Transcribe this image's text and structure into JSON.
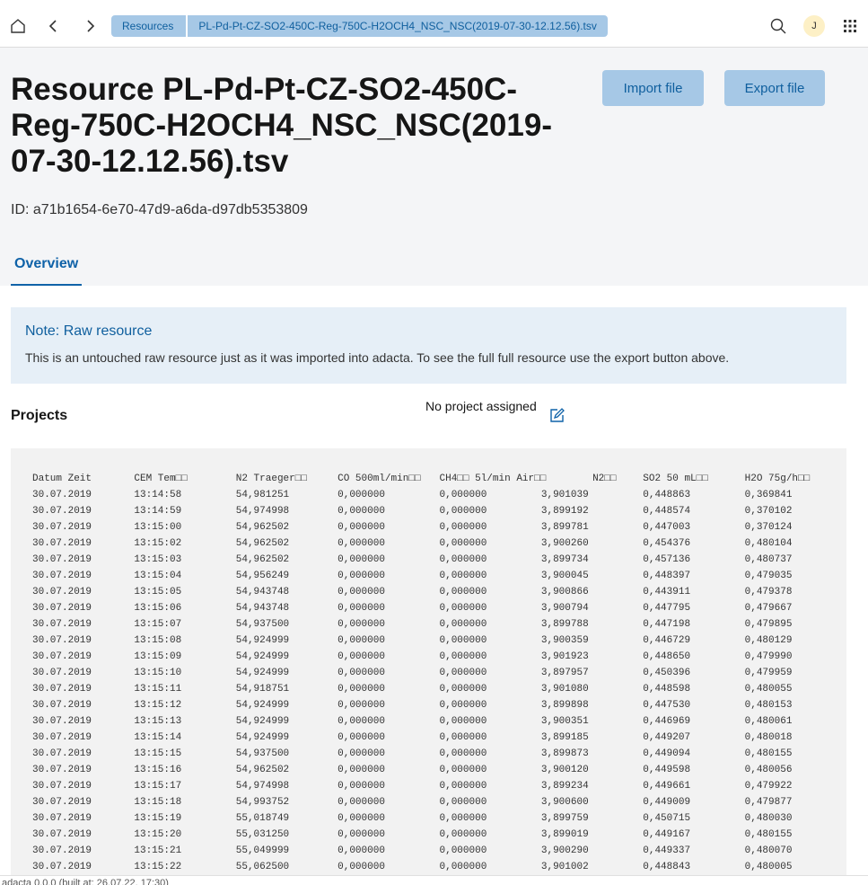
{
  "breadcrumb": {
    "first": "Resources",
    "second": "PL-Pd-Pt-CZ-SO2-450C-Reg-750C-H2OCH4_NSC_NSC(2019-07-30-12.12.56).tsv"
  },
  "header": {
    "avatar_initial": "J"
  },
  "page": {
    "title": "Resource PL-Pd-Pt-CZ-SO2-450C-Reg-750C-H2OCH4_NSC_NSC(2019-07-30-12.12.56).tsv",
    "id_text": "ID: a71b1654-6e70-47d9-a6da-d97db5353809",
    "import_label": "Import file",
    "export_label": "Export file",
    "tab_overview": "Overview"
  },
  "note": {
    "title": "Note: Raw resource",
    "text": "This is an untouched raw resource just as it was imported into adacta. To see the full full resource use the export button above."
  },
  "projects": {
    "label": "Projects",
    "value": "No project assigned"
  },
  "table": {
    "header": [
      "Datum   Zeit",
      "CEM Tem□□",
      "N2 Traeger□□",
      "CO 500ml/min□□",
      "CH4□□   5l/min Air□□",
      "",
      "N2□□",
      "SO2 50 mL□□",
      "H2O 75g/h□□"
    ],
    "rows": [
      [
        "30.07.2019",
        "13:14:58",
        "54,981251",
        "0,000000",
        "0,000000",
        "3,901039",
        "0,448863",
        "0,369841"
      ],
      [
        "30.07.2019",
        "13:14:59",
        "54,974998",
        "0,000000",
        "0,000000",
        "3,899192",
        "0,448574",
        "0,370102"
      ],
      [
        "30.07.2019",
        "13:15:00",
        "54,962502",
        "0,000000",
        "0,000000",
        "3,899781",
        "0,447003",
        "0,370124"
      ],
      [
        "30.07.2019",
        "13:15:02",
        "54,962502",
        "0,000000",
        "0,000000",
        "3,900260",
        "0,454376",
        "0,480104"
      ],
      [
        "30.07.2019",
        "13:15:03",
        "54,962502",
        "0,000000",
        "0,000000",
        "3,899734",
        "0,457136",
        "0,480737"
      ],
      [
        "30.07.2019",
        "13:15:04",
        "54,956249",
        "0,000000",
        "0,000000",
        "3,900045",
        "0,448397",
        "0,479035"
      ],
      [
        "30.07.2019",
        "13:15:05",
        "54,943748",
        "0,000000",
        "0,000000",
        "3,900866",
        "0,443911",
        "0,479378"
      ],
      [
        "30.07.2019",
        "13:15:06",
        "54,943748",
        "0,000000",
        "0,000000",
        "3,900794",
        "0,447795",
        "0,479667"
      ],
      [
        "30.07.2019",
        "13:15:07",
        "54,937500",
        "0,000000",
        "0,000000",
        "3,899788",
        "0,447198",
        "0,479895"
      ],
      [
        "30.07.2019",
        "13:15:08",
        "54,924999",
        "0,000000",
        "0,000000",
        "3,900359",
        "0,446729",
        "0,480129"
      ],
      [
        "30.07.2019",
        "13:15:09",
        "54,924999",
        "0,000000",
        "0,000000",
        "3,901923",
        "0,448650",
        "0,479990"
      ],
      [
        "30.07.2019",
        "13:15:10",
        "54,924999",
        "0,000000",
        "0,000000",
        "3,897957",
        "0,450396",
        "0,479959"
      ],
      [
        "30.07.2019",
        "13:15:11",
        "54,918751",
        "0,000000",
        "0,000000",
        "3,901080",
        "0,448598",
        "0,480055"
      ],
      [
        "30.07.2019",
        "13:15:12",
        "54,924999",
        "0,000000",
        "0,000000",
        "3,899898",
        "0,447530",
        "0,480153"
      ],
      [
        "30.07.2019",
        "13:15:13",
        "54,924999",
        "0,000000",
        "0,000000",
        "3,900351",
        "0,446969",
        "0,480061"
      ],
      [
        "30.07.2019",
        "13:15:14",
        "54,924999",
        "0,000000",
        "0,000000",
        "3,899185",
        "0,449207",
        "0,480018"
      ],
      [
        "30.07.2019",
        "13:15:15",
        "54,937500",
        "0,000000",
        "0,000000",
        "3,899873",
        "0,449094",
        "0,480155"
      ],
      [
        "30.07.2019",
        "13:15:16",
        "54,962502",
        "0,000000",
        "0,000000",
        "3,900120",
        "0,449598",
        "0,480056"
      ],
      [
        "30.07.2019",
        "13:15:17",
        "54,974998",
        "0,000000",
        "0,000000",
        "3,899234",
        "0,449661",
        "0,479922"
      ],
      [
        "30.07.2019",
        "13:15:18",
        "54,993752",
        "0,000000",
        "0,000000",
        "3,900600",
        "0,449009",
        "0,479877"
      ],
      [
        "30.07.2019",
        "13:15:19",
        "55,018749",
        "0,000000",
        "0,000000",
        "3,899759",
        "0,450715",
        "0,480030"
      ],
      [
        "30.07.2019",
        "13:15:20",
        "55,031250",
        "0,000000",
        "0,000000",
        "3,899019",
        "0,449167",
        "0,480155"
      ],
      [
        "30.07.2019",
        "13:15:21",
        "55,049999",
        "0,000000",
        "0,000000",
        "3,900290",
        "0,449337",
        "0,480070"
      ],
      [
        "30.07.2019",
        "13:15:22",
        "55,062500",
        "0,000000",
        "0,000000",
        "3,901002",
        "0,448843",
        "0,480005"
      ]
    ]
  },
  "footer": {
    "text": "adacta 0.0.0 (built at: 26.07.22, 17:30)"
  },
  "icons": {
    "home": "home-icon",
    "back": "chevron-left-icon",
    "forward": "chevron-right-icon",
    "search": "search-icon",
    "apps": "app-grid-icon",
    "edit": "edit-icon"
  },
  "colors": {
    "accent": "#0f62a8",
    "button_bg": "#a6c8e6",
    "note_bg": "#e6eff7",
    "avatar_bg": "#fdf0c6"
  }
}
